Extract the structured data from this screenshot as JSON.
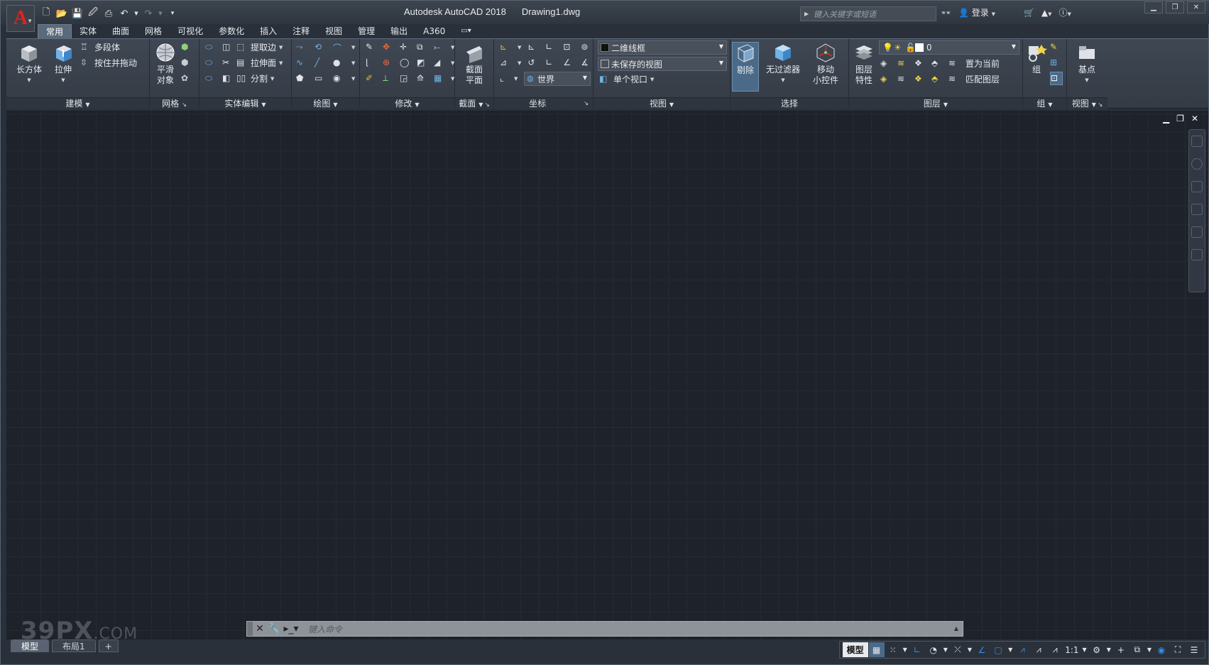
{
  "app": {
    "menu_letter": "A",
    "product": "Autodesk AutoCAD 2018",
    "document": "Drawing1.dwg",
    "search_placeholder": "键入关键字或短语",
    "login": "登录"
  },
  "tabs": [
    "常用",
    "实体",
    "曲面",
    "网格",
    "可视化",
    "参数化",
    "插入",
    "注释",
    "视图",
    "管理",
    "输出",
    "A360"
  ],
  "active_tab": "常用",
  "panels": {
    "modeling": {
      "title": "建模",
      "box": "长方体",
      "extrude": "拉伸",
      "polysolid": "多段体",
      "presspull": "按住并拖动"
    },
    "mesh": {
      "title": "网格",
      "smooth_line1": "平滑",
      "smooth_line2": "对象"
    },
    "solid_edit": {
      "title": "实体编辑",
      "extract_edges": "提取边",
      "extrude_faces": "拉伸面",
      "separate": "分割"
    },
    "draw": {
      "title": "绘图"
    },
    "modify": {
      "title": "修改"
    },
    "section": {
      "title": "截面",
      "plane_line1": "截面",
      "plane_line2": "平面"
    },
    "coordinates": {
      "title": "坐标",
      "ucs_world": "世界"
    },
    "view": {
      "title": "视图",
      "visual_style": "二维线框",
      "named_view": "未保存的视图",
      "viewport": "单个视口"
    },
    "selection": {
      "title": "选择",
      "culling": "剔除",
      "no_filter": "无过滤器",
      "gizmo_line1": "移动",
      "gizmo_line2": "小控件"
    },
    "layers": {
      "title": "图层",
      "props_line1": "图层",
      "props_line2": "特性",
      "current_layer": "0",
      "make_current": "置为当前",
      "match_layer": "匹配图层"
    },
    "groups": {
      "title": "组",
      "group": "组"
    },
    "view2": {
      "title": "视图",
      "base": "基点"
    }
  },
  "command_line": {
    "placeholder": "键入命令"
  },
  "layout_tabs": [
    "模型",
    "布局1"
  ],
  "statusbar": {
    "model": "模型",
    "scale": "1:1"
  },
  "watermark": {
    "main": "39PX",
    "suffix": ".COM"
  },
  "colors": {
    "accent": "#2f8fe8",
    "logo_red": "#e2231a",
    "canvas": "#1e222a"
  }
}
